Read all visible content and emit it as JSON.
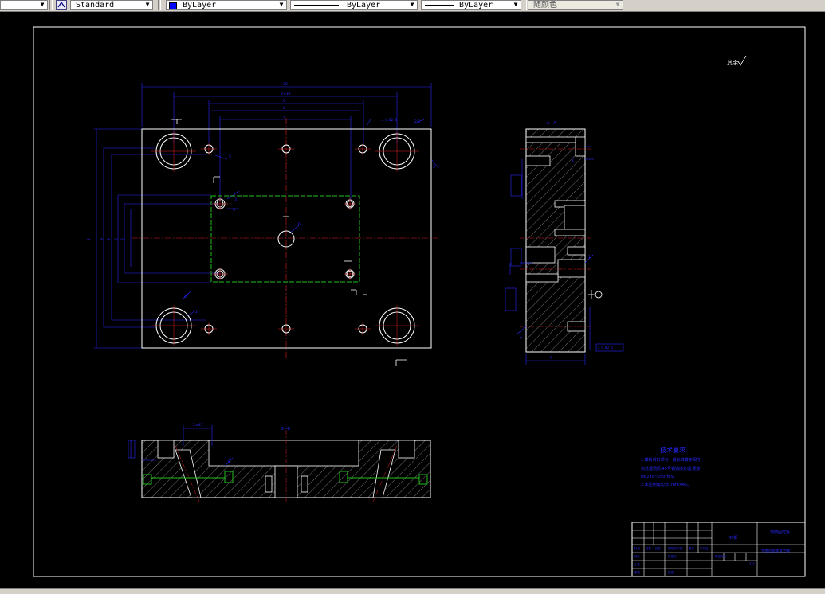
{
  "toolbar": {
    "text_style": "Standard",
    "layer_color": "ByLayer",
    "linetype": "ByLayer",
    "lineweight": "ByLayer",
    "plot_style": "随颜色"
  },
  "drawing": {
    "surface_note": "其余",
    "tech_title": "技术要求",
    "tech_lines": [
      "1.模板材料须与一般标准模架相符,",
      "热处理调质,45号钢调质处理,硬度",
      "HB230~250HBS。",
      "2.未注倒角均为1mm×45。"
    ],
    "section_labels": {
      "aa": "A—A",
      "bb": "B—B"
    },
    "datum_b": "B"
  },
  "title_block": {
    "material": "45钢",
    "part_name": "动模固定板",
    "drawing_no": "垫圈后座板复合模",
    "scale": "1:1"
  }
}
